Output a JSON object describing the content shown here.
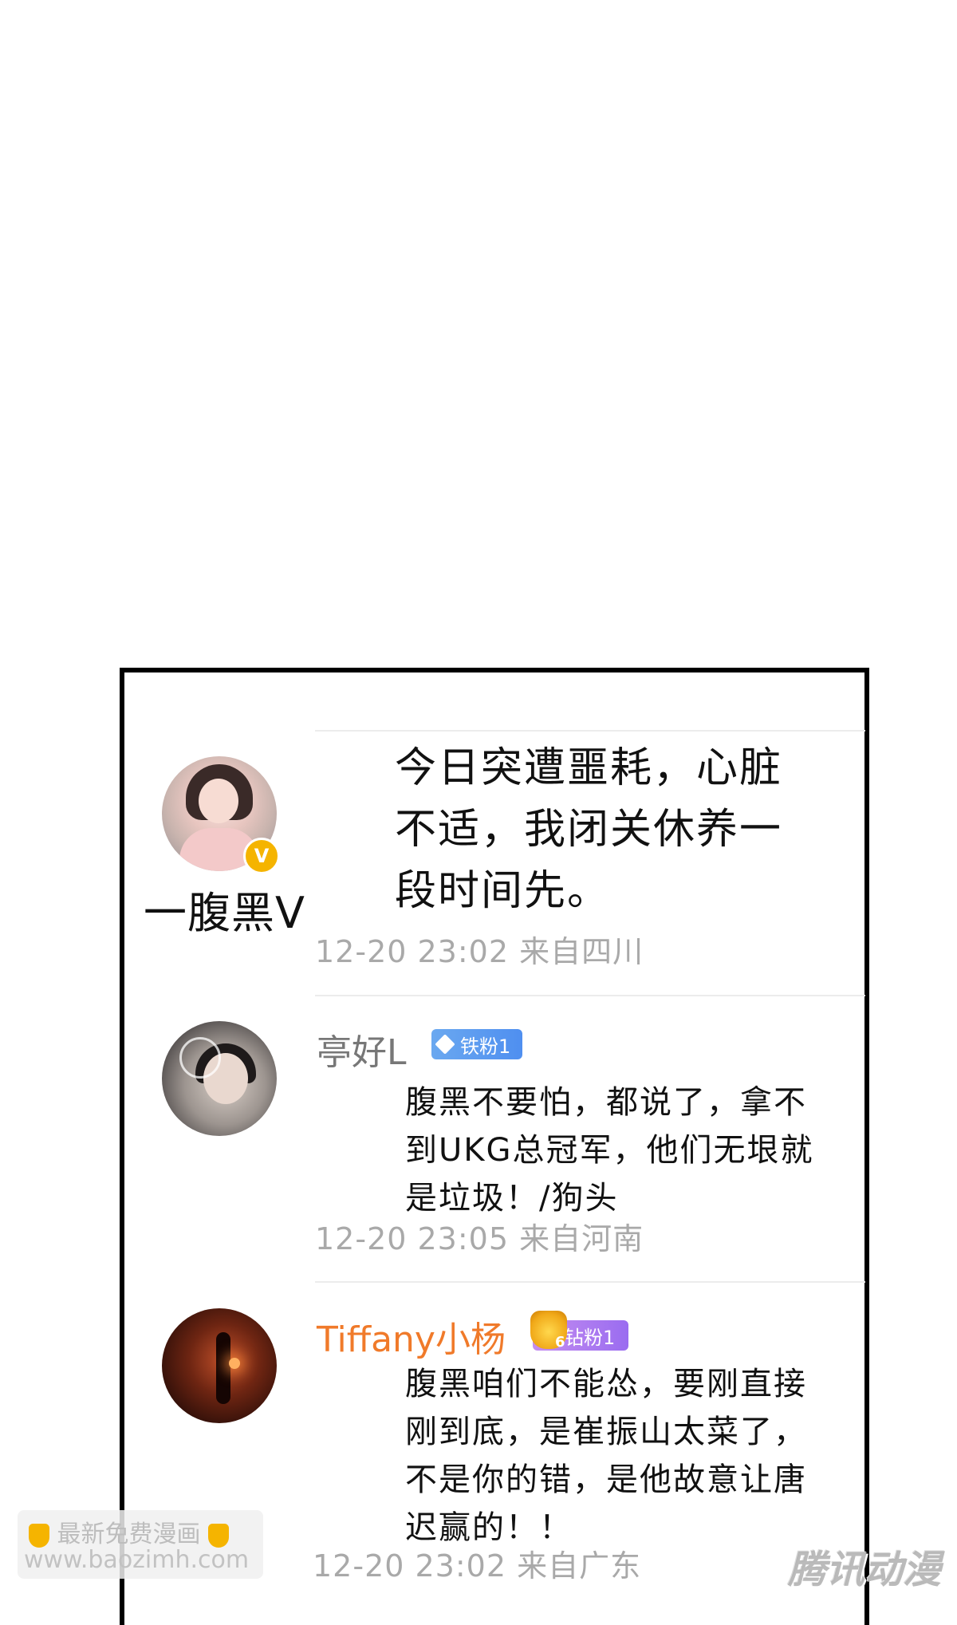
{
  "post": {
    "author": "一腹黑V",
    "text": "今日突遭噩耗，心脏不适，我闭关休养一段时间先。",
    "meta": "12-20 23:02 来自四川",
    "verified_badge": "V"
  },
  "comments": [
    {
      "name": "亭好L",
      "badge": "铁粉1",
      "text": "腹黑不要怕，都说了，拿不到UKG总冠军，他们无垠就是垃圾！/狗头",
      "meta": "12-20 23:05 来自河南"
    },
    {
      "name": "Tiffany小杨",
      "badge": "钻粉1",
      "badge_level": "6",
      "text": "腹黑咱们不能怂，要刚直接刚到底，是崔振山太菜了，不是你的错，是他故意让唐迟赢的！！",
      "meta": "12-20 23:02 来自广东"
    }
  ],
  "watermark": {
    "line1": "最新免费漫画",
    "line2": "www.baozimh.com",
    "brand": "腾讯动漫"
  }
}
